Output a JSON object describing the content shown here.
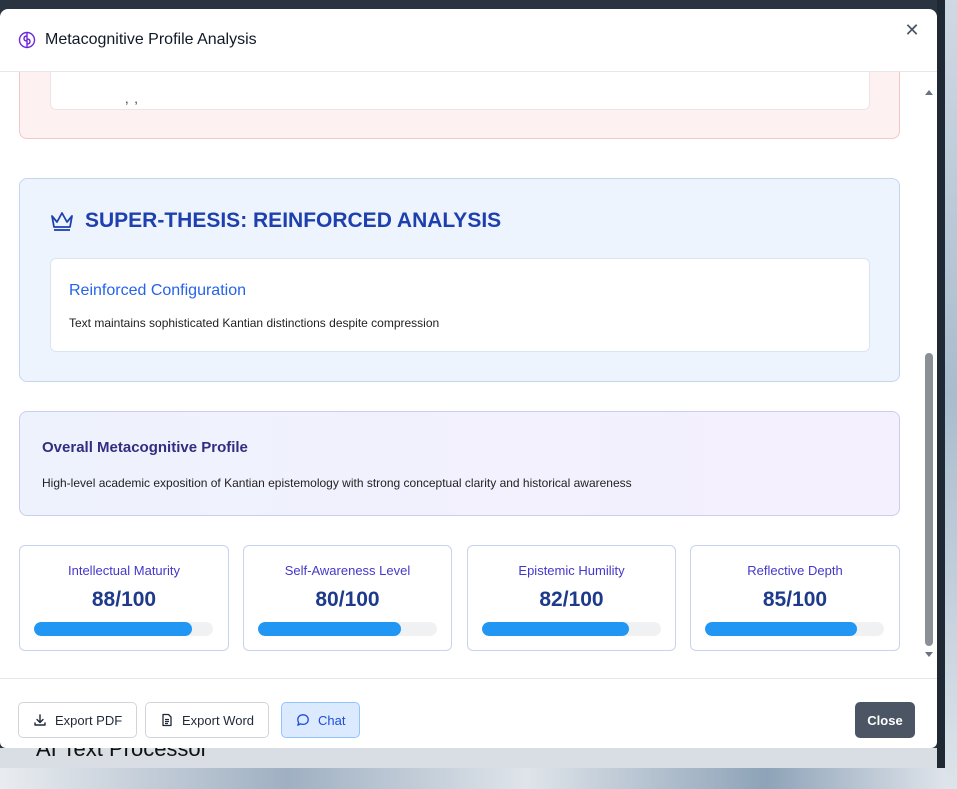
{
  "background": {
    "app_title": "AI Text Processor"
  },
  "modal": {
    "title": "Metacognitive Profile Analysis",
    "close_icon": "close-icon",
    "header_icon": "brain-icon"
  },
  "super_thesis": {
    "icon": "crown-icon",
    "title": "SUPER-THESIS: REINFORCED ANALYSIS",
    "card_title": "Reinforced Configuration",
    "card_text": "Text maintains sophisticated Kantian distinctions despite compression"
  },
  "overall": {
    "title": "Overall Metacognitive Profile",
    "text": "High-level academic exposition of Kantian epistemology with strong conceptual clarity and historical awareness"
  },
  "metrics": [
    {
      "label": "Intellectual Maturity",
      "value_text": "88/100",
      "value": 88
    },
    {
      "label": "Self-Awareness Level",
      "value_text": "80/100",
      "value": 80
    },
    {
      "label": "Epistemic Humility",
      "value_text": "82/100",
      "value": 82
    },
    {
      "label": "Reflective Depth",
      "value_text": "85/100",
      "value": 85
    }
  ],
  "footer": {
    "export_pdf": "Export PDF",
    "export_word": "Export Word",
    "chat": "Chat",
    "close": "Close"
  },
  "colors": {
    "accent": "#1e40af",
    "progress": "#2196f3",
    "close_button": "#4b5563"
  }
}
